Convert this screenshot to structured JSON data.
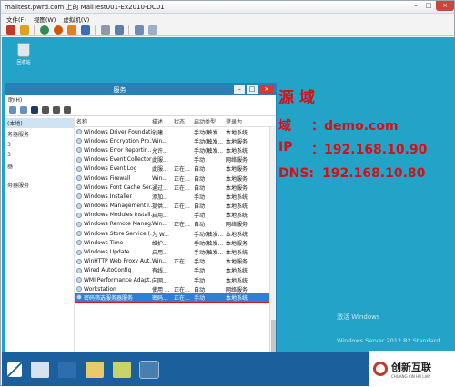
{
  "vm": {
    "title": "mailtest.pwrd.com 上的 MailTest001-Ex2010-DC01",
    "menu": [
      "文件(F)",
      "视图(W)",
      "虚拟机(V)"
    ],
    "controls": [
      "–",
      "□",
      "×"
    ]
  },
  "desktop": {
    "recycle_bin_label": "回收站",
    "watermark_line1": "激活 Windows",
    "watermark_line2": "Windows Server 2012 R2 Standard"
  },
  "services": {
    "title": "服务",
    "menu_partial": "助(H)",
    "tree": {
      "selected": "(本地)",
      "items": [
        "务器服务",
        "3",
        "3",
        "器",
        "务器服务"
      ]
    },
    "columns": {
      "name": "名称",
      "desc": "描述",
      "status": "状态",
      "startup": "启动类型",
      "logon": "登录为"
    },
    "rows": [
      {
        "name": "Windows Driver Foundati...",
        "desc": "创建...",
        "status": "",
        "startup": "手动(触发...",
        "logon": "本地系统"
      },
      {
        "name": "Windows Encryption Pro...",
        "desc": "Win...",
        "status": "",
        "startup": "手动(触发...",
        "logon": "本地服务"
      },
      {
        "name": "Windows Error Reportin...",
        "desc": "允许...",
        "status": "",
        "startup": "手动(触发...",
        "logon": "本地系统"
      },
      {
        "name": "Windows Event Collector",
        "desc": "此服...",
        "status": "",
        "startup": "手动",
        "logon": "网络服务"
      },
      {
        "name": "Windows Event Log",
        "desc": "此服...",
        "status": "正在...",
        "startup": "自动",
        "logon": "本地服务"
      },
      {
        "name": "Windows Firewall",
        "desc": "Win...",
        "status": "正在...",
        "startup": "自动",
        "logon": "本地服务"
      },
      {
        "name": "Windows Font Cache Ser...",
        "desc": "通过...",
        "status": "正在...",
        "startup": "自动",
        "logon": "本地服务"
      },
      {
        "name": "Windows Installer",
        "desc": "添加...",
        "status": "",
        "startup": "手动",
        "logon": "本地系统"
      },
      {
        "name": "Windows Management I...",
        "desc": "提供...",
        "status": "正在...",
        "startup": "自动",
        "logon": "本地系统"
      },
      {
        "name": "Windows Modules Install...",
        "desc": "启用...",
        "status": "",
        "startup": "手动",
        "logon": "本地系统"
      },
      {
        "name": "Windows Remote Manag...",
        "desc": "Win...",
        "status": "正在...",
        "startup": "自动",
        "logon": "网络服务"
      },
      {
        "name": "Windows Store Service (...",
        "desc": "为 W...",
        "status": "",
        "startup": "手动(触发...",
        "logon": "本地系统"
      },
      {
        "name": "Windows Time",
        "desc": "维护...",
        "status": "",
        "startup": "手动(触发...",
        "logon": "本地服务"
      },
      {
        "name": "Windows Update",
        "desc": "启用...",
        "status": "",
        "startup": "手动(触发...",
        "logon": "本地系统"
      },
      {
        "name": "WinHTTP Web Proxy Aut...",
        "desc": "Win...",
        "status": "正在...",
        "startup": "手动",
        "logon": "本地服务"
      },
      {
        "name": "Wired AutoConfig",
        "desc": "有线...",
        "status": "",
        "startup": "手动",
        "logon": "本地系统"
      },
      {
        "name": "WMI Performance Adapt...",
        "desc": "向网...",
        "status": "",
        "startup": "手动",
        "logon": "本地系统"
      },
      {
        "name": "Workstation",
        "desc": "使用 ...",
        "status": "正在...",
        "startup": "自动",
        "logon": "网络服务"
      },
      {
        "name": "密码筛选服务器服务",
        "desc": "密码...",
        "status": "正在...",
        "startup": "手动",
        "logon": "本地系统",
        "selected": true
      }
    ]
  },
  "overlay": {
    "heading": "源 域",
    "line1_label": "域",
    "line1_value": "：demo.com",
    "line2_label": "IP",
    "line2_value": "：192.168.10.90",
    "line3_label": "DNS:",
    "line3_value": "192.168.10.80"
  },
  "logo": {
    "cn": "创新互联",
    "en": "CHUANG XIN HU LIAN"
  }
}
